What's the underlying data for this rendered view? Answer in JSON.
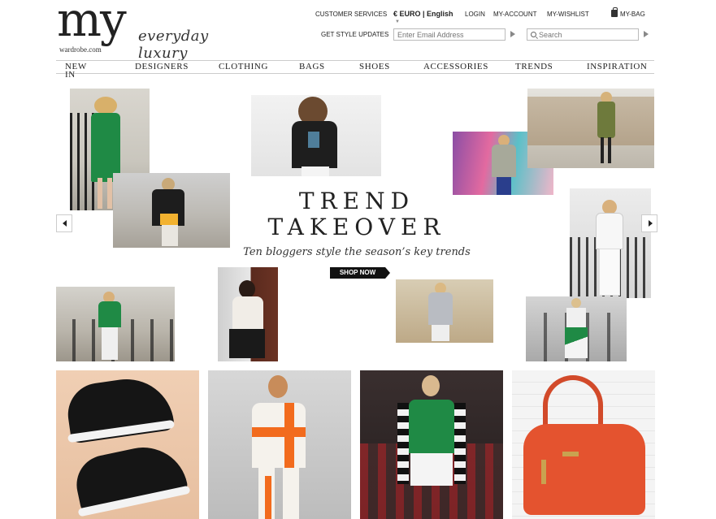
{
  "logo": {
    "main": "my",
    "sub": "wardrobe.com",
    "tagline": "everyday luxury"
  },
  "utility": {
    "customer_services": "CUSTOMER SERVICES",
    "currency": "€ EURO | English",
    "login": "LOGIN",
    "account": "MY-ACCOUNT",
    "wishlist": "MY-WISHLIST",
    "bag": "MY-BAG"
  },
  "newsletter": {
    "label": "GET STYLE UPDATES",
    "placeholder": "Enter Email Address"
  },
  "search": {
    "placeholder": "Search"
  },
  "nav": {
    "items": [
      "NEW IN",
      "DESIGNERS",
      "CLOTHING",
      "BAGS",
      "SHOES",
      "ACCESSORIES",
      "TRENDS",
      "INSPIRATION"
    ]
  },
  "hero": {
    "title_line1": "TREND",
    "title_line2": "TAKEOVER",
    "subtitle": "Ten bloggers style the season’s key trends",
    "cta": "SHOP NOW"
  },
  "products": [
    {
      "icon": "studded-sneakers-image"
    },
    {
      "icon": "runway-look-orange-image"
    },
    {
      "icon": "runway-look-green-image"
    },
    {
      "icon": "orange-handbag-image"
    }
  ],
  "colors": {
    "accent_green": "#1f8a45",
    "handbag_orange": "#e4532f",
    "cta_black": "#111111"
  }
}
